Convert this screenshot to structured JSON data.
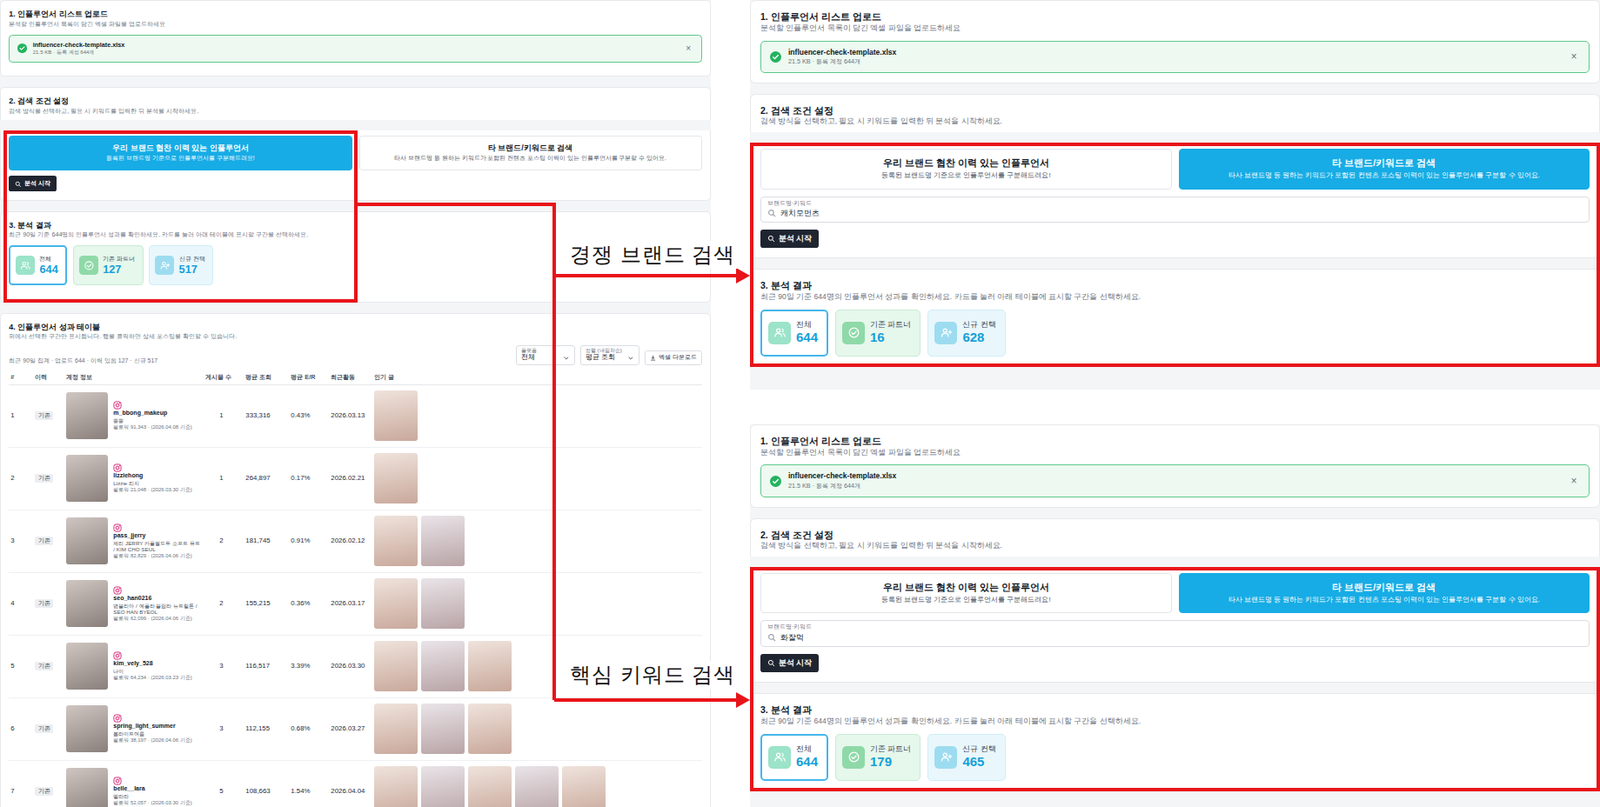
{
  "annotations": [
    {
      "label": "경쟁 브랜드 검색"
    },
    {
      "label": "핵심 키워드 검색"
    }
  ],
  "screens": [
    {
      "upload": {
        "title": "1. 인플루언서 리스트 업로드",
        "desc": "분석할 인플루언서 목록이 담긴 엑셀 파일을 업로드하세요",
        "file_name": "influencer-check-template.xlsx",
        "file_meta": "21.5 KB · 등록 계정 644개",
        "close": "×"
      },
      "search": {
        "title": "2. 검색 조건 설정",
        "desc": "검색 방식을 선택하고, 필요 시 키워드를 입력한 뒤 분석을 시작하세요.",
        "modes": [
          {
            "title": "우리 브랜드 협찬 이력 있는 인플루언서",
            "desc": "등록된 브랜드명 기준으로 인플루언서를 구분해드려요!",
            "selected": true
          },
          {
            "title": "타 브랜드/키워드로 검색",
            "desc": "타사 브랜드명 등 원하는 키워드가 포함된 컨텐츠 포스팅 이력이 있는 인플루언서를 구분할 수 있어요.",
            "selected": false
          }
        ],
        "button": "분석 시작"
      },
      "results": {
        "title": "3. 분석 결과",
        "desc": "최근 90일 기준 644명의 인플루언서 성과를 확인하세요. 카드를 눌러 아래 테이블에 표시할 구간을 선택하세요.",
        "cards": [
          {
            "kind": "all",
            "label": "전체",
            "value": "644",
            "selected": true,
            "color": "#9be3c9"
          },
          {
            "kind": "partner",
            "label": "기존 파트너",
            "value": "127",
            "selected": false,
            "color": "#8fd9a8"
          },
          {
            "kind": "new",
            "label": "신규 컨택",
            "value": "517",
            "selected": false,
            "color": "#9ddcf0"
          }
        ]
      },
      "table": {
        "title": "4. 인플루언서 성과 테이블",
        "desc": "위에서 선택한 구간만 표시됩니다. 행을 클릭하면 상세 포스팅을 확인할 수 있습니다.",
        "summary": "최근 90일 집계 · 업로드 644 · 이력 있음 127 · 신규 517",
        "filters": [
          {
            "label": "플랫폼",
            "value": "전체"
          },
          {
            "label": "정렬 (내림차순)",
            "value": "평균 조회"
          }
        ],
        "download": "엑셀 다운로드",
        "columns": [
          "#",
          "이력",
          "계정 정보",
          "게시물 수",
          "평균 조회",
          "평균 E/R",
          "최근활동",
          "인기 글"
        ],
        "rows": [
          {
            "rank": "1",
            "badge": "기존",
            "username": "m_bbong_makeup",
            "name": "뿡뿡",
            "followers": "팔로워 91,343 · (2026.04.08 기준)",
            "posts": "1",
            "avg_views": "333,316",
            "avg_er": "0.43%",
            "last_active": "2026.03.13",
            "thumbnails": 1
          },
          {
            "rank": "2",
            "badge": "기존",
            "username": "lizziehong",
            "name": "Lizzie 리지",
            "followers": "팔로워 21,048 · (2026.03.30 기준)",
            "posts": "1",
            "avg_views": "264,897",
            "avg_er": "0.17%",
            "last_active": "2026.02.21",
            "thumbnails": 1
          },
          {
            "rank": "3",
            "badge": "기존",
            "username": "pass_jjerry",
            "name": "제리 JERRY 카플월드투 소프트 뮤트 / KIM CHO SEUL",
            "followers": "팔로워 82,829 · (2026.04.06 기준)",
            "posts": "2",
            "avg_views": "181,745",
            "avg_er": "0.91%",
            "last_active": "2026.02.12",
            "thumbnails": 2
          },
          {
            "rank": "4",
            "badge": "기존",
            "username": "seo_han0216",
            "name": "병블리아 / 예플라 블랍라 뉴트럴톤 / SEO HAN BYEOL",
            "followers": "팔로워 62,099 · (2026.04.06 기준)",
            "posts": "2",
            "avg_views": "155,215",
            "avg_er": "0.36%",
            "last_active": "2026.03.17",
            "thumbnails": 2
          },
          {
            "rank": "5",
            "badge": "기존",
            "username": "kim_vely_528",
            "name": "나이",
            "followers": "팔로워 64,234 · (2026.03.23 기준)",
            "posts": "3",
            "avg_views": "116,517",
            "avg_er": "3.39%",
            "last_active": "2026.03.30",
            "thumbnails": 3
          },
          {
            "rank": "6",
            "badge": "기존",
            "username": "spring_light_summer",
            "name": "봄라이트여름",
            "followers": "팔로워 38,197 · (2026.04.06 기준)",
            "posts": "3",
            "avg_views": "112,155",
            "avg_er": "0.68%",
            "last_active": "2026.03.27",
            "thumbnails": 3
          },
          {
            "rank": "7",
            "badge": "기존",
            "username": "belle__lara",
            "name": "벨라라",
            "followers": "팔로워 52,057 · (2026.03.30 기준)",
            "posts": "5",
            "avg_views": "108,663",
            "avg_er": "1.54%",
            "last_active": "2026.04.04",
            "thumbnails": 5
          }
        ]
      }
    },
    {
      "upload": {
        "title": "1. 인플루언서 리스트 업로드",
        "desc": "분석할 인플루언서 목록이 담긴 엑셀 파일을 업로드하세요",
        "file_name": "influencer-check-template.xlsx",
        "file_meta": "21.5 KB · 등록 계정 644개",
        "close": "×"
      },
      "search": {
        "title": "2. 검색 조건 설정",
        "desc": "검색 방식을 선택하고, 필요 시 키워드를 입력한 뒤 분석을 시작하세요.",
        "modes": [
          {
            "title": "우리 브랜드 협찬 이력 있는 인플루언서",
            "desc": "등록된 브랜드명 기준으로 인플루언서를 구분해드려요!",
            "selected": false
          },
          {
            "title": "타 브랜드/키워드로 검색",
            "desc": "타사 브랜드명 등 원하는 키워드가 포함된 컨텐츠 포스팅 이력이 있는 인플루언서를 구분할 수 있어요.",
            "selected": true
          }
        ],
        "keyword": {
          "label": "브랜드명·키워드",
          "value": "캐치모먼츠"
        },
        "button": "분석 시작"
      },
      "results": {
        "title": "3. 분석 결과",
        "desc": "최근 90일 기준 644명의 인플루언서 성과를 확인하세요. 카드를 눌러 아래 테이블에 표시할 구간을 선택하세요.",
        "cards": [
          {
            "kind": "all",
            "label": "전체",
            "value": "644",
            "selected": true,
            "color": "#9be3c9"
          },
          {
            "kind": "partner",
            "label": "기존 파트너",
            "value": "16",
            "selected": false,
            "color": "#8fd9a8"
          },
          {
            "kind": "new",
            "label": "신규 컨택",
            "value": "628",
            "selected": false,
            "color": "#9ddcf0"
          }
        ]
      }
    },
    {
      "upload": {
        "title": "1. 인플루언서 리스트 업로드",
        "desc": "분석할 인플루언서 목록이 담긴 엑셀 파일을 업로드하세요",
        "file_name": "influencer-check-template.xlsx",
        "file_meta": "21.5 KB · 등록 계정 644개",
        "close": "×"
      },
      "search": {
        "title": "2. 검색 조건 설정",
        "desc": "검색 방식을 선택하고, 필요 시 키워드를 입력한 뒤 분석을 시작하세요.",
        "modes": [
          {
            "title": "우리 브랜드 협찬 이력 있는 인플루언서",
            "desc": "등록된 브랜드명 기준으로 인플루언서를 구분해드려요!",
            "selected": false
          },
          {
            "title": "타 브랜드/키워드로 검색",
            "desc": "타사 브랜드명 등 원하는 키워드가 포함된 컨텐츠 포스팅 이력이 있는 인플루언서를 구분할 수 있어요.",
            "selected": true
          }
        ],
        "keyword": {
          "label": "브랜드명·키워드",
          "value": "화잘먹"
        },
        "button": "분석 시작"
      },
      "results": {
        "title": "3. 분석 결과",
        "desc": "최근 90일 기준 644명의 인플루언서 성과를 확인하세요. 카드를 눌러 아래 테이블에 표시할 구간을 선택하세요.",
        "cards": [
          {
            "kind": "all",
            "label": "전체",
            "value": "644",
            "selected": true,
            "color": "#9be3c9"
          },
          {
            "kind": "partner",
            "label": "기존 파트너",
            "value": "179",
            "selected": false,
            "color": "#8fd9a8"
          },
          {
            "kind": "new",
            "label": "신규 컨택",
            "value": "465",
            "selected": false,
            "color": "#9ddcf0"
          }
        ]
      }
    }
  ]
}
